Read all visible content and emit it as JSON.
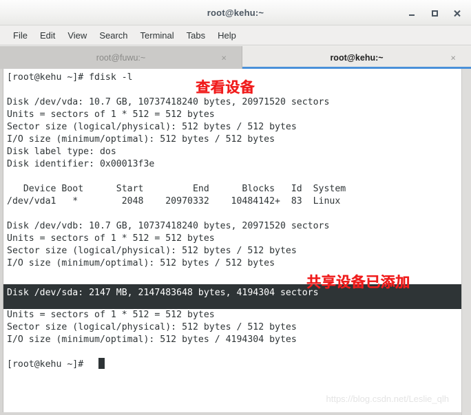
{
  "window": {
    "title": "root@kehu:~",
    "controls": {
      "minimize": "minimize-button",
      "maximize": "maximize-button",
      "close": "close-button"
    }
  },
  "menubar": {
    "items": [
      {
        "label": "File"
      },
      {
        "label": "Edit"
      },
      {
        "label": "View"
      },
      {
        "label": "Search"
      },
      {
        "label": "Terminal"
      },
      {
        "label": "Tabs"
      },
      {
        "label": "Help"
      }
    ]
  },
  "tabs": [
    {
      "label": "root@fuwu:~",
      "active": false,
      "close": "×"
    },
    {
      "label": "root@kehu:~",
      "active": true,
      "close": "×"
    }
  ],
  "terminal": {
    "prompt_command_line": "[root@kehu ~]# fdisk -l",
    "body_top": "[root@kehu ~]# fdisk -l\n\nDisk /dev/vda: 10.7 GB, 10737418240 bytes, 20971520 sectors\nUnits = sectors of 1 * 512 = 512 bytes\nSector size (logical/physical): 512 bytes / 512 bytes\nI/O size (minimum/optimal): 512 bytes / 512 bytes\nDisk label type: dos\nDisk identifier: 0x00013f3e\n\n   Device Boot      Start         End      Blocks   Id  System\n/dev/vda1   *        2048    20970332    10484142+  83  Linux\n\nDisk /dev/vdb: 10.7 GB, 10737418240 bytes, 20971520 sectors\nUnits = sectors of 1 * 512 = 512 bytes\nSector size (logical/physical): 512 bytes / 512 bytes\nI/O size (minimum/optimal): 512 bytes / 512 bytes\n",
    "highlighted_line": "Disk /dev/sda: 2147 MB, 2147483648 bytes, 4194304 sectors",
    "body_bottom": "Units = sectors of 1 * 512 = 512 bytes\nSector size (logical/physical): 512 bytes / 512 bytes\nI/O size (minimum/optimal): 512 bytes / 4194304 bytes\n\n[root@kehu ~]# ",
    "lines": [
      "[root@kehu ~]# fdisk -l",
      "",
      "Disk /dev/vda: 10.7 GB, 10737418240 bytes, 20971520 sectors",
      "Units = sectors of 1 * 512 = 512 bytes",
      "Sector size (logical/physical): 512 bytes / 512 bytes",
      "I/O size (minimum/optimal): 512 bytes / 512 bytes",
      "Disk label type: dos",
      "Disk identifier: 0x00013f3e",
      "",
      "   Device Boot      Start         End      Blocks   Id  System",
      "/dev/vda1   *        2048    20970332    10484142+  83  Linux",
      "",
      "Disk /dev/vdb: 10.7 GB, 10737418240 bytes, 20971520 sectors",
      "Units = sectors of 1 * 512 = 512 bytes",
      "Sector size (logical/physical): 512 bytes / 512 bytes",
      "I/O size (minimum/optimal): 512 bytes / 512 bytes",
      "",
      "Disk /dev/sda: 2147 MB, 2147483648 bytes, 4194304 sectors",
      "Units = sectors of 1 * 512 = 512 bytes",
      "Sector size (logical/physical): 512 bytes / 512 bytes",
      "I/O size (minimum/optimal): 512 bytes / 4194304 bytes",
      "",
      "[root@kehu ~]# "
    ],
    "partition_table": {
      "headers": [
        "Device",
        "Boot",
        "Start",
        "End",
        "Blocks",
        "Id",
        "System"
      ],
      "rows": [
        [
          "/dev/vda1",
          "*",
          "2048",
          "20970332",
          "10484142+",
          "83",
          "Linux"
        ]
      ]
    },
    "disks": [
      {
        "device": "/dev/vda",
        "size": "10.7 GB",
        "bytes": "10737418240",
        "sectors": "20971520",
        "units": "sectors of 1 * 512 = 512 bytes",
        "sector_size": "512 bytes / 512 bytes",
        "io_size": "512 bytes / 512 bytes",
        "label_type": "dos",
        "identifier": "0x00013f3e"
      },
      {
        "device": "/dev/vdb",
        "size": "10.7 GB",
        "bytes": "10737418240",
        "sectors": "20971520",
        "units": "sectors of 1 * 512 = 512 bytes",
        "sector_size": "512 bytes / 512 bytes",
        "io_size": "512 bytes / 512 bytes"
      },
      {
        "device": "/dev/sda",
        "size": "2147 MB",
        "bytes": "2147483648",
        "sectors": "4194304",
        "units": "sectors of 1 * 512 = 512 bytes",
        "sector_size": "512 bytes / 512 bytes",
        "io_size": "512 bytes / 4194304 bytes"
      }
    ]
  },
  "annotations": [
    {
      "text": "查看设备",
      "color": "#f01c1c"
    },
    {
      "text": "共享设备已添加",
      "color": "#f01c1c"
    }
  ],
  "watermark": "https://blog.csdn.net/Leslie_qlh",
  "colors": {
    "accent": "#4a90d9",
    "annotation_red": "#f01c1c",
    "terminal_bg": "#ffffff",
    "terminal_fg": "#2e3436",
    "selection_bg": "#2e3436"
  }
}
